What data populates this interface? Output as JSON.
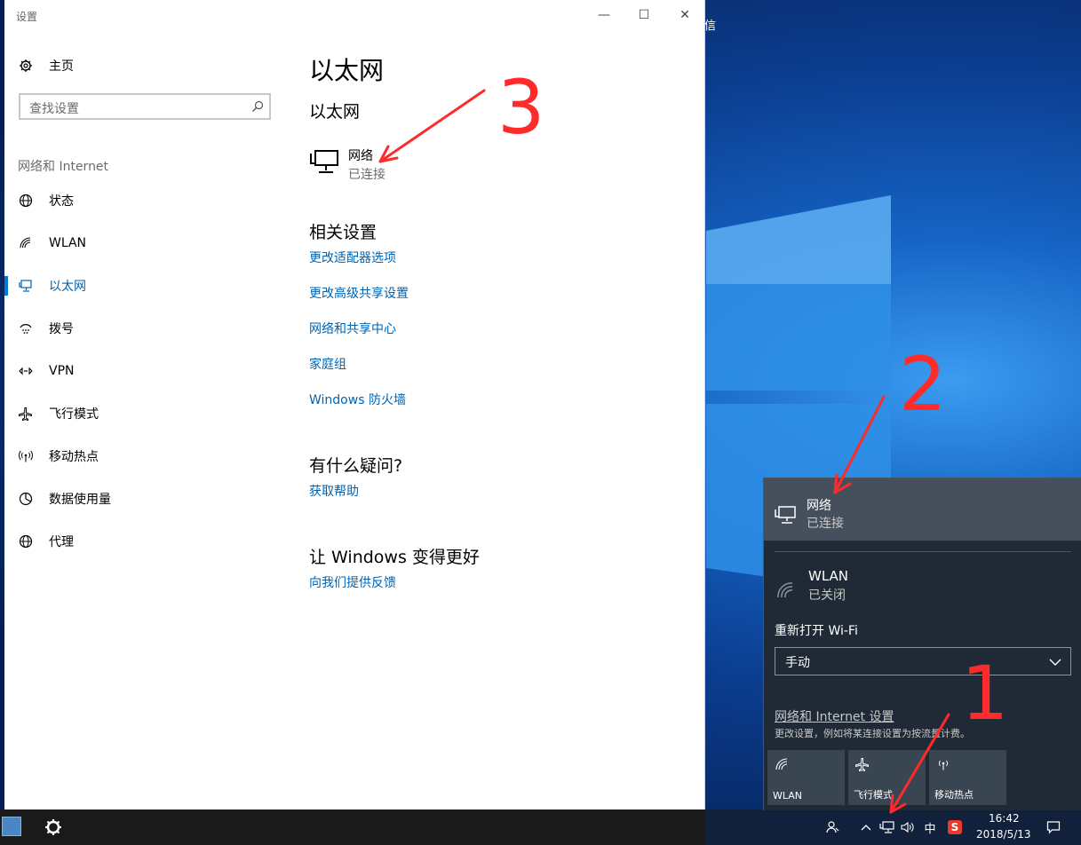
{
  "window": {
    "title": "设置"
  },
  "desktop": {
    "icon_label_1": "信"
  },
  "nav": {
    "home": "主页",
    "search_placeholder": "查找设置",
    "section": "网络和 Internet",
    "items": [
      {
        "label": "状态",
        "icon": "globe-icon"
      },
      {
        "label": "WLAN",
        "icon": "wifi-icon"
      },
      {
        "label": "以太网",
        "icon": "ethernet-icon",
        "active": true
      },
      {
        "label": "拨号",
        "icon": "dialup-icon"
      },
      {
        "label": "VPN",
        "icon": "vpn-icon"
      },
      {
        "label": "飞行模式",
        "icon": "airplane-icon"
      },
      {
        "label": "移动热点",
        "icon": "hotspot-icon"
      },
      {
        "label": "数据使用量",
        "icon": "data-usage-icon"
      },
      {
        "label": "代理",
        "icon": "globe-icon"
      }
    ]
  },
  "main": {
    "title": "以太网",
    "subtitle": "以太网",
    "network": {
      "name": "网络",
      "status": "已连接"
    },
    "related_heading": "相关设置",
    "related_links": [
      "更改适配器选项",
      "更改高级共享设置",
      "网络和共享中心",
      "家庭组",
      "Windows 防火墙"
    ],
    "question_heading": "有什么疑问?",
    "question_link": "获取帮助",
    "feedback_heading": "让 Windows 变得更好",
    "feedback_link": "向我们提供反馈"
  },
  "flyout": {
    "network": {
      "name": "网络",
      "status": "已连接"
    },
    "wlan": {
      "name": "WLAN",
      "status": "已关闭"
    },
    "reopen_label": "重新打开 Wi-Fi",
    "reopen_value": "手动",
    "settings_link": "网络和 Internet 设置",
    "settings_desc": "更改设置，例如将某连接设置为按流量计费。",
    "tiles": [
      "WLAN",
      "飞行模式",
      "移动热点"
    ]
  },
  "taskbar": {
    "ime": "中",
    "time": "16:42",
    "date": "2018/5/13"
  },
  "annotations": [
    "1",
    "2",
    "3"
  ],
  "colors": {
    "accent": "#0078d7",
    "link": "#0063b1",
    "annotation": "#ff2a2a"
  }
}
